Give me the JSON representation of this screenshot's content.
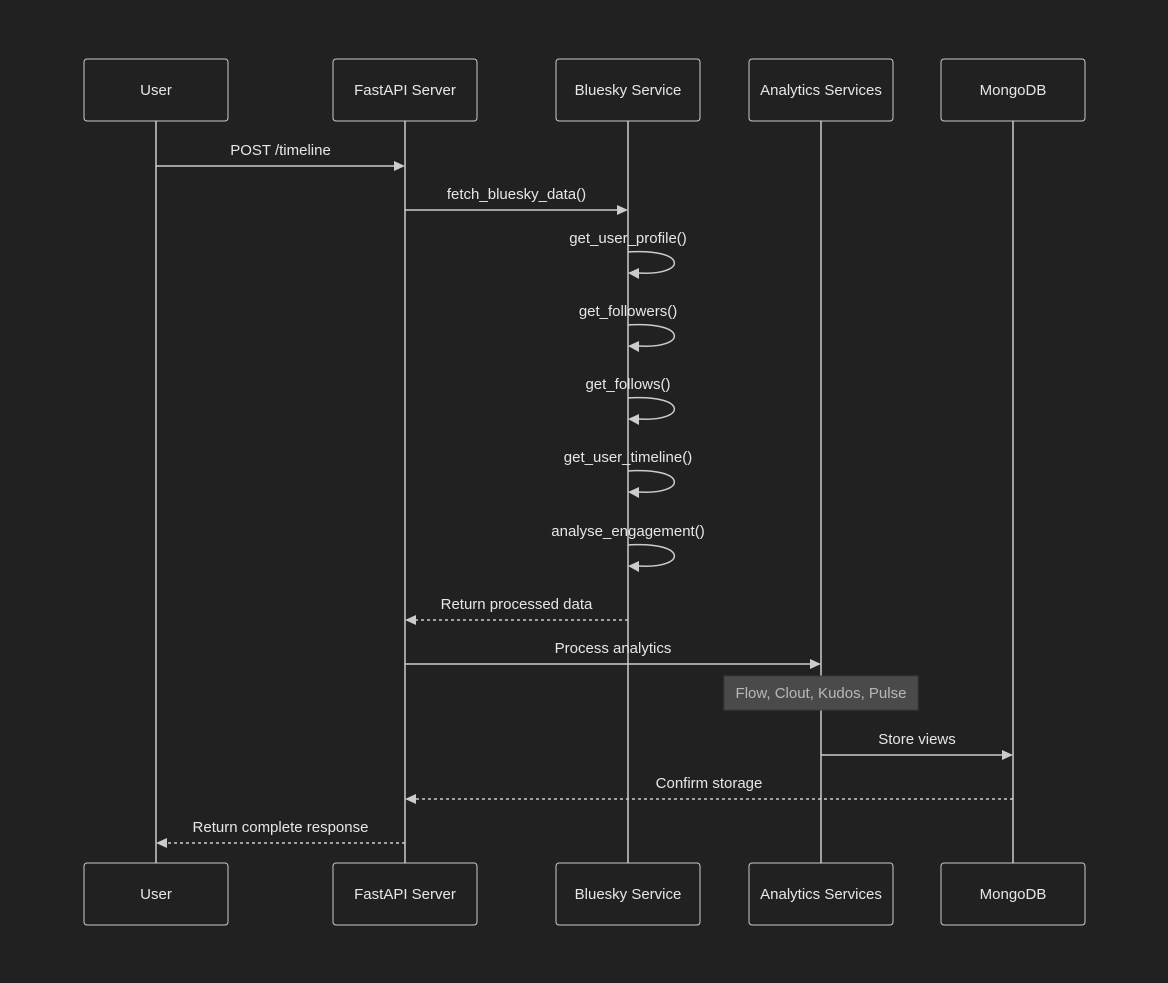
{
  "diagram": {
    "type": "sequence",
    "participants": [
      {
        "id": "user",
        "label": "User"
      },
      {
        "id": "fastapi",
        "label": "FastAPI Server"
      },
      {
        "id": "bluesky",
        "label": "Bluesky Service"
      },
      {
        "id": "analytics",
        "label": "Analytics Services"
      },
      {
        "id": "mongodb",
        "label": "MongoDB"
      }
    ],
    "messages": [
      {
        "from": "user",
        "to": "fastapi",
        "label": "POST /timeline",
        "style": "solid"
      },
      {
        "from": "fastapi",
        "to": "bluesky",
        "label": "fetch_bluesky_data()",
        "style": "solid"
      },
      {
        "from": "bluesky",
        "to": "bluesky",
        "label": "get_user_profile()",
        "style": "solid"
      },
      {
        "from": "bluesky",
        "to": "bluesky",
        "label": "get_followers()",
        "style": "solid"
      },
      {
        "from": "bluesky",
        "to": "bluesky",
        "label": "get_follows()",
        "style": "solid"
      },
      {
        "from": "bluesky",
        "to": "bluesky",
        "label": "get_user_timeline()",
        "style": "solid"
      },
      {
        "from": "bluesky",
        "to": "bluesky",
        "label": "analyse_engagement()",
        "style": "solid"
      },
      {
        "from": "bluesky",
        "to": "fastapi",
        "label": "Return processed data",
        "style": "dashed"
      },
      {
        "from": "fastapi",
        "to": "analytics",
        "label": "Process analytics",
        "style": "solid"
      },
      {
        "note": true,
        "over": "analytics",
        "label": "Flow, Clout, Kudos, Pulse"
      },
      {
        "from": "analytics",
        "to": "mongodb",
        "label": "Store views",
        "style": "solid"
      },
      {
        "from": "mongodb",
        "to": "fastapi",
        "label": "Confirm storage",
        "style": "dashed"
      },
      {
        "from": "fastapi",
        "to": "user",
        "label": "Return complete response",
        "style": "dashed"
      }
    ]
  }
}
